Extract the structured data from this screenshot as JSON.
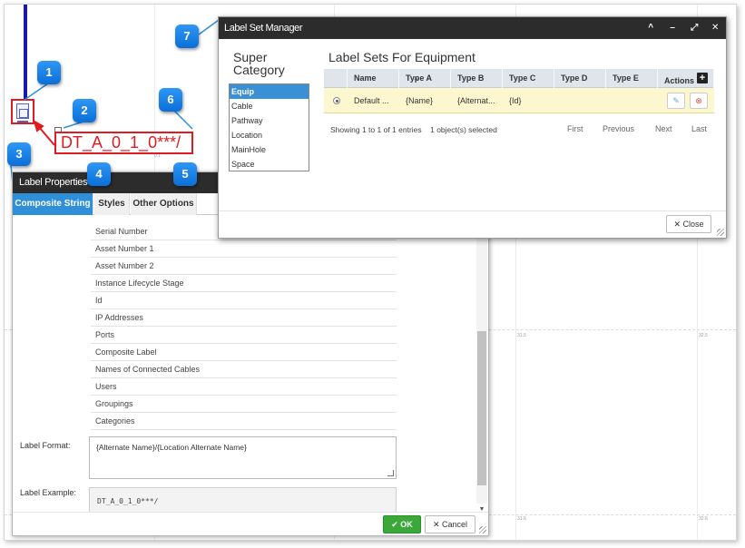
{
  "callouts": [
    "1",
    "2",
    "3",
    "4",
    "5",
    "6",
    "7"
  ],
  "canvas": {
    "label_text": "DT_A_0_1_0***/",
    "grid_labels": [
      "31.5",
      "32.5",
      "31.6",
      "32.6",
      "0.1"
    ]
  },
  "label_properties": {
    "title": "Label Properties",
    "tabs": [
      "Composite String",
      "Styles",
      "Other Options"
    ],
    "fields": [
      "Serial Number",
      "Asset Number 1",
      "Asset Number 2",
      "Instance Lifecycle Stage",
      "Id",
      "IP Addresses",
      "Ports",
      "Composite Label",
      "Names of Connected Cables",
      "Users",
      "Groupings",
      "Categories"
    ],
    "format_label": "Label Format:",
    "format_value": "{Alternate Name}/{Location Alternate Name}",
    "example_label": "Label Example:",
    "example_value": "DT_A_0_1_0***/",
    "ok_label": "OK",
    "cancel_label": "Cancel"
  },
  "label_set_manager": {
    "title": "Label Set Manager",
    "controls": [
      "^",
      "–",
      "⤢",
      "✕"
    ],
    "super_category_heading": "Super Category",
    "super_categories": [
      "Equip",
      "Cable",
      "Pathway",
      "Location",
      "MainHole",
      "Space"
    ],
    "selected_category": "Equip",
    "label_sets_heading": "Label Sets For Equipment",
    "columns": [
      "Name",
      "Type A",
      "Type B",
      "Type C",
      "Type D",
      "Type E",
      "Actions"
    ],
    "rows": [
      {
        "name": "Default ...",
        "type_a": "{Name}",
        "type_b": "{Alternat...",
        "type_c": "{Id}",
        "type_d": "",
        "type_e": ""
      }
    ],
    "entries_info": "Showing 1 to 1 of 1 entries",
    "selection_info": "1 object(s) selected",
    "pager": [
      "First",
      "Previous",
      "Next",
      "Last"
    ],
    "close_label": "Close"
  },
  "colors": {
    "accent": "#2f8fd8",
    "highlight_red": "#e01b22",
    "badge_blue": "#1a7ee6",
    "ok_green": "#3aa93a",
    "row_selected": "#fdf7cf"
  }
}
